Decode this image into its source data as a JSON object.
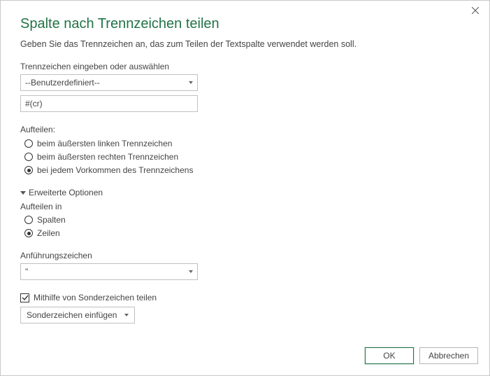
{
  "title": "Spalte nach Trennzeichen teilen",
  "subtitle": "Geben Sie das Trennzeichen an, das zum Teilen der Textspalte verwendet werden soll.",
  "delimiter": {
    "label": "Trennzeichen eingeben oder auswählen",
    "selected": "--Benutzerdefiniert--",
    "custom_value": "#(cr)"
  },
  "split_at": {
    "label": "Aufteilen:",
    "options": {
      "left": "beim äußersten linken Trennzeichen",
      "right": "beim äußersten rechten Trennzeichen",
      "each": "bei jedem Vorkommen des Trennzeichens"
    },
    "selected": "each"
  },
  "advanced": {
    "label": "Erweiterte Optionen",
    "split_into": {
      "label": "Aufteilen in",
      "options": {
        "columns": "Spalten",
        "rows": "Zeilen"
      },
      "selected": "rows"
    },
    "quote": {
      "label": "Anführungszeichen",
      "value": "\""
    },
    "special": {
      "checkbox_label": "Mithilfe von Sonderzeichen teilen",
      "checked": true,
      "insert_label": "Sonderzeichen einfügen"
    }
  },
  "buttons": {
    "ok": "OK",
    "cancel": "Abbrechen"
  }
}
